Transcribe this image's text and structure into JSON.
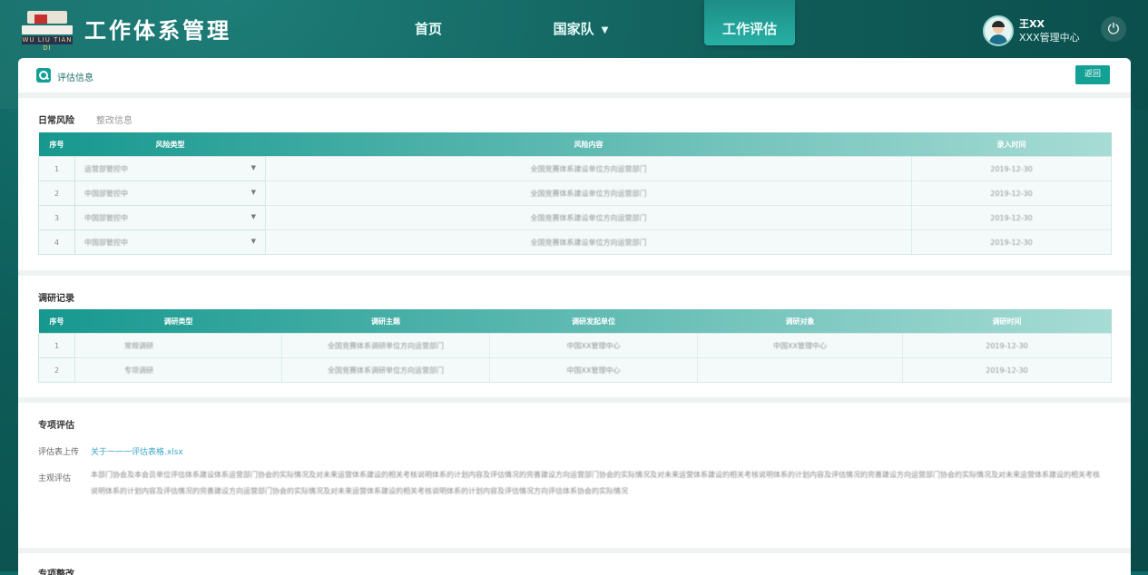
{
  "header": {
    "logo_text": "WU LIU TIAN DI",
    "title": "工作体系管理",
    "nav": [
      {
        "label": "首页"
      },
      {
        "label": "国家队"
      },
      {
        "label": "工作评估"
      }
    ],
    "user": {
      "name": "王XX",
      "org": "XXX管理中心"
    }
  },
  "panel": {
    "title": "评估信息",
    "back_label": "返回"
  },
  "daily_risk": {
    "title": "日常风险",
    "sub": "整改信息",
    "columns": [
      "序号",
      "风险类型",
      "风险内容",
      "录入时间"
    ],
    "rows": [
      {
        "no": "1",
        "type": "运营部管控中",
        "content": "全国竞赛体系建设单位方向运营部门",
        "time": "2019-12-30"
      },
      {
        "no": "2",
        "type": "中国部管控中",
        "content": "全国竞赛体系建设单位方向运营部门",
        "time": "2019-12-30"
      },
      {
        "no": "3",
        "type": "中国部管控中",
        "content": "全国竞赛体系建设单位方向运营部门",
        "time": "2019-12-30"
      },
      {
        "no": "4",
        "type": "中国部管控中",
        "content": "全国竞赛体系建设单位方向运营部门",
        "time": "2019-12-30"
      }
    ]
  },
  "research": {
    "title": "调研记录",
    "columns": [
      "序号",
      "调研类型",
      "调研主题",
      "调研发起单位",
      "调研对象",
      "调研时间"
    ],
    "rows": [
      {
        "no": "1",
        "type": "常规调研",
        "topic": "全国竞赛体系调研单位方向运营部门",
        "unit": "中国XX管理中心",
        "target": "中国XX管理中心",
        "time": "2019-12-30"
      },
      {
        "no": "2",
        "type": "专项调研",
        "topic": "全国竞赛体系调研单位方向运营部门",
        "unit": "中国XX管理中心",
        "target": "",
        "time": "2019-12-30"
      }
    ]
  },
  "special": {
    "title": "专项评估",
    "upload_label": "评估表上传",
    "upload_link": "关于一一一评估表格.xlsx",
    "main_label": "主观评估",
    "main_text": "本部门协会及本会员单位评估体系建设体系运营部门协会的实际情况及对未来运营体系建设的相关考核说明体系的计划内容及评估情况的完善建设方向运营部门协会的实际情况及对未来运营体系建设的相关考核说明体系的计划内容及评估情况的完善建设方向运营部门协会的实际情况及对未来运营体系建设的相关考核说明体系的计划内容及评估情况的完善建设方向运营部门协会的实际情况及对未来运营体系建设的相关考核说明体系的计划内容及评估情况方向评估体系协会的实际情况"
  },
  "next_section": {
    "title": "专项整改"
  },
  "colors": {
    "header_bg": "#0d5c59",
    "accent": "#13a095",
    "table_head": "#17a096"
  }
}
